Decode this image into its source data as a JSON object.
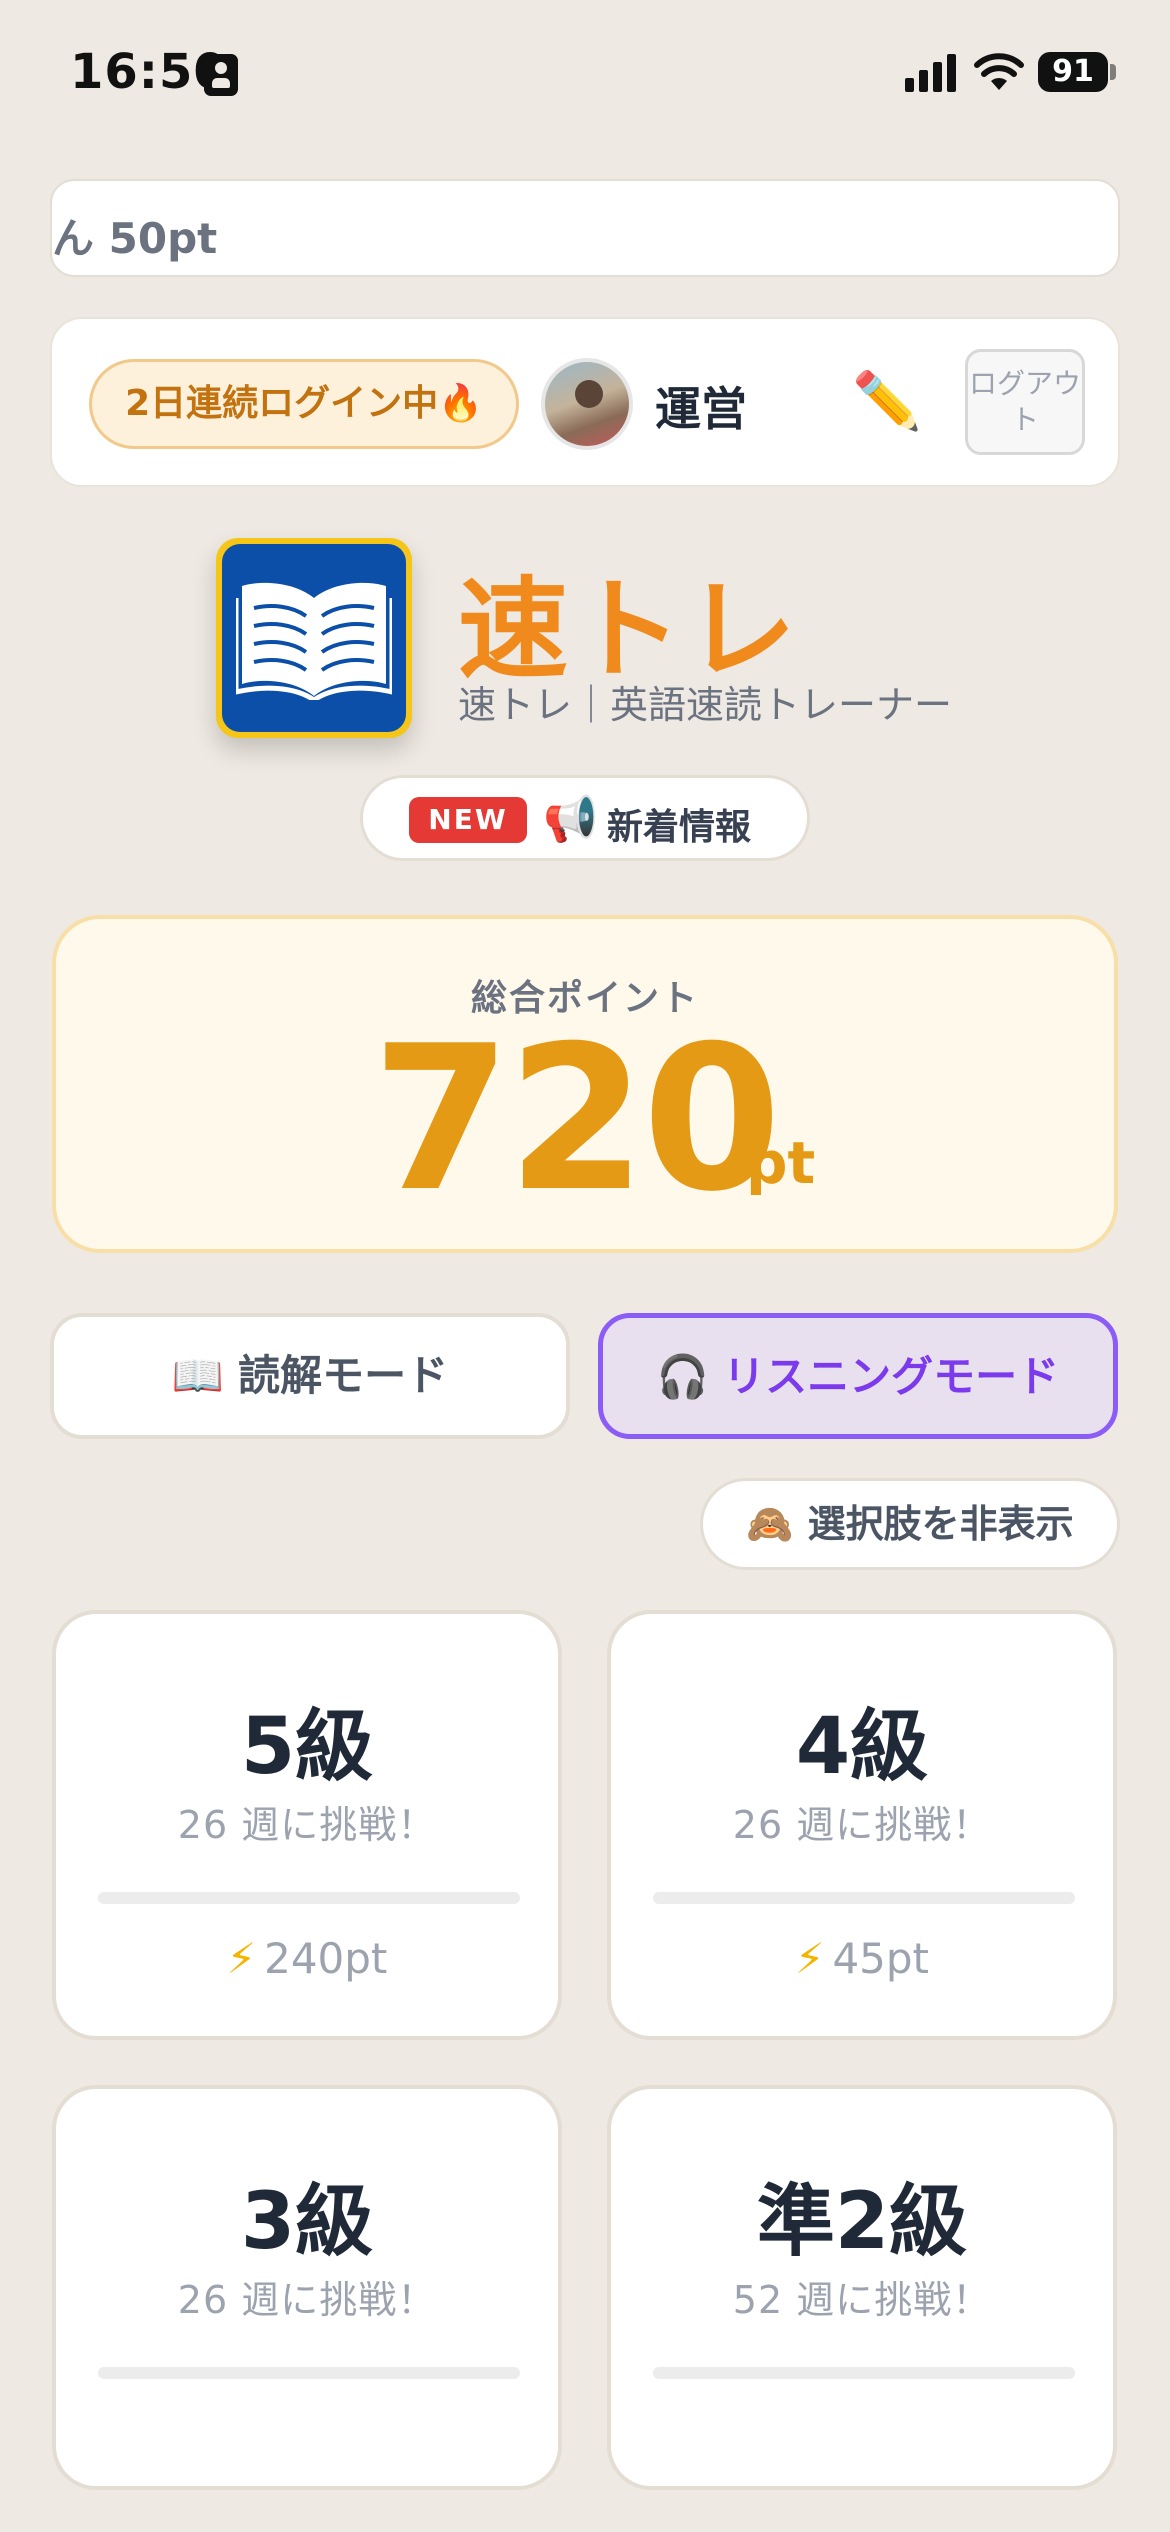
{
  "status_bar": {
    "time": "16:50",
    "battery": "91"
  },
  "ticker": {
    "text": "ん 50pt"
  },
  "user": {
    "streak": "2日連続ログイン中🔥",
    "name": "運営",
    "edit_icon": "✏️",
    "logout": "ログアウト"
  },
  "app": {
    "title": "速トレ",
    "subtitle": "速トレ｜英語速読トレーナー"
  },
  "news": {
    "badge": "NEW",
    "icon": "📢",
    "label": "新着情報"
  },
  "points": {
    "label": "総合ポイント",
    "value": "720",
    "unit": "pt"
  },
  "modes": [
    {
      "icon": "📖",
      "label": "読解モード"
    },
    {
      "icon": "🎧",
      "label": "リスニングモード"
    }
  ],
  "hide_options": {
    "icon": "🙈",
    "label": "選択肢を非表示"
  },
  "grades": [
    {
      "title": "5級",
      "sub": "26 週に挑戦！",
      "bolt": "⚡",
      "pts": "240pt"
    },
    {
      "title": "4級",
      "sub": "26 週に挑戦！",
      "bolt": "⚡",
      "pts": "45pt"
    },
    {
      "title": "3級",
      "sub": "26 週に挑戦！"
    },
    {
      "title": "準2級",
      "sub": "52 週に挑戦！"
    }
  ],
  "colors": {
    "accent": "#F08A1C",
    "points": "#E59A16",
    "listening": "#8B5CF6",
    "background": "#EEE9E2"
  }
}
